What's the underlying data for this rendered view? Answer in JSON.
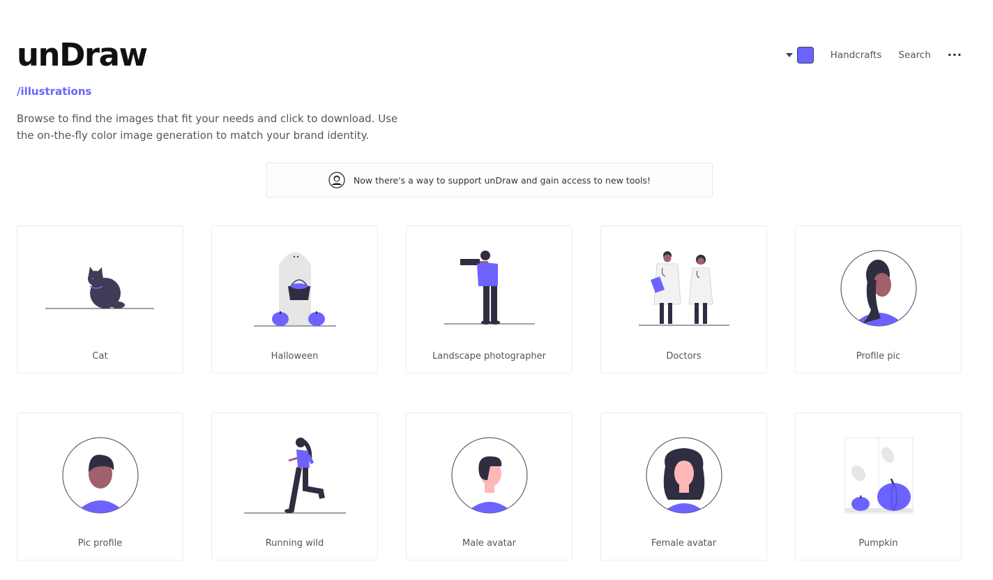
{
  "brand": {
    "logo": "unDraw",
    "subtitle": "/illustrations"
  },
  "description": "Browse to find the images that fit your needs and click to download. Use the on-the-fly color image generation to match your brand identity.",
  "nav": {
    "color": "#6c63ff",
    "handcrafts": "Handcrafts",
    "search": "Search",
    "more": "···"
  },
  "banner": {
    "text": "Now there's a way to support unDraw and gain access to new tools!"
  },
  "colors": {
    "accent": "#6c63ff",
    "dark": "#2f2e41",
    "skin": "#a0616a"
  },
  "illustrations": [
    {
      "title": "Cat"
    },
    {
      "title": "Halloween"
    },
    {
      "title": "Landscape photographer"
    },
    {
      "title": "Doctors"
    },
    {
      "title": "Profile pic"
    },
    {
      "title": "Pic profile"
    },
    {
      "title": "Running wild"
    },
    {
      "title": "Male avatar"
    },
    {
      "title": "Female avatar"
    },
    {
      "title": "Pumpkin"
    }
  ]
}
